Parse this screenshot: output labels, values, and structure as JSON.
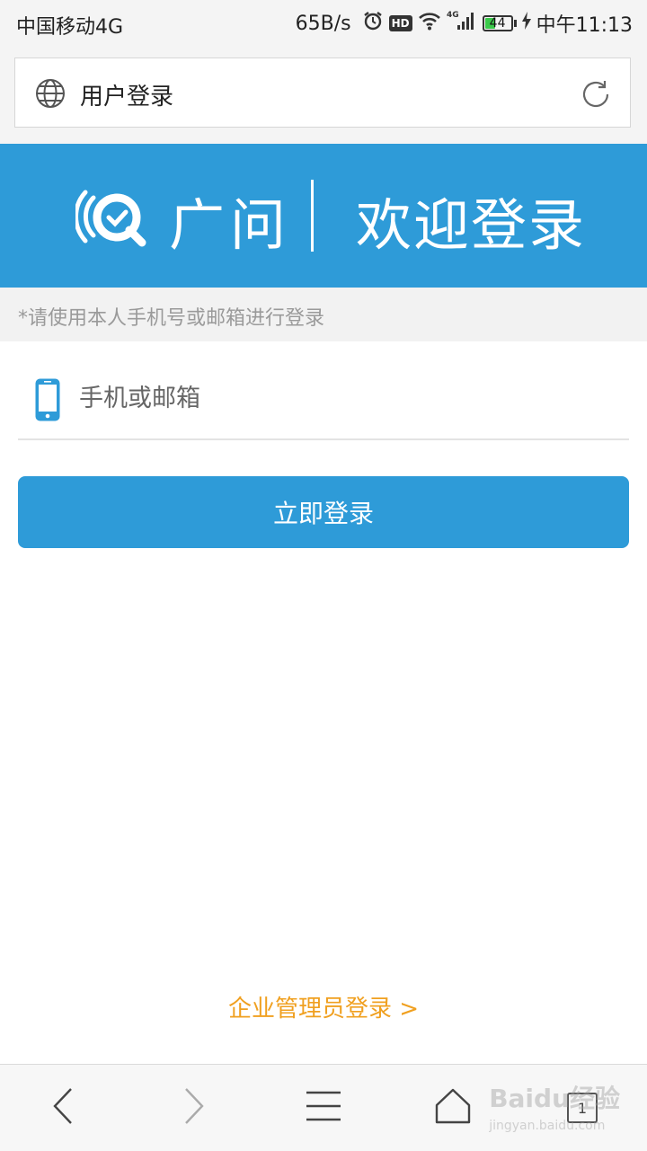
{
  "status_bar": {
    "carrier": "中国移动4G",
    "speed": "65B/s",
    "hd_badge": "HD",
    "battery_level": "44",
    "time": "中午11:13",
    "icons": [
      "alarm-icon",
      "hd-icon",
      "wifi-icon",
      "signal-4g-icon",
      "battery-icon",
      "charging-icon"
    ]
  },
  "browser": {
    "page_title": "用户登录",
    "icons": [
      "globe-icon",
      "reload-icon"
    ]
  },
  "banner": {
    "brand": "广问",
    "welcome": "欢迎登录",
    "color": "#2e9bd8"
  },
  "form": {
    "hint": "*请使用本人手机号或邮箱进行登录",
    "account_placeholder": "手机或邮箱",
    "submit_label": "立即登录"
  },
  "footer": {
    "admin_link": "企业管理员登录 >"
  },
  "bottom_nav": {
    "tab_count": "1",
    "icons": [
      "back-icon",
      "forward-icon",
      "menu-icon",
      "home-icon",
      "tabs-icon"
    ]
  },
  "watermark": {
    "text": "Baidu经验",
    "sub": "jingyan.baidu.com"
  },
  "colors": {
    "accent": "#2e9bd8",
    "link": "#f0a020"
  }
}
